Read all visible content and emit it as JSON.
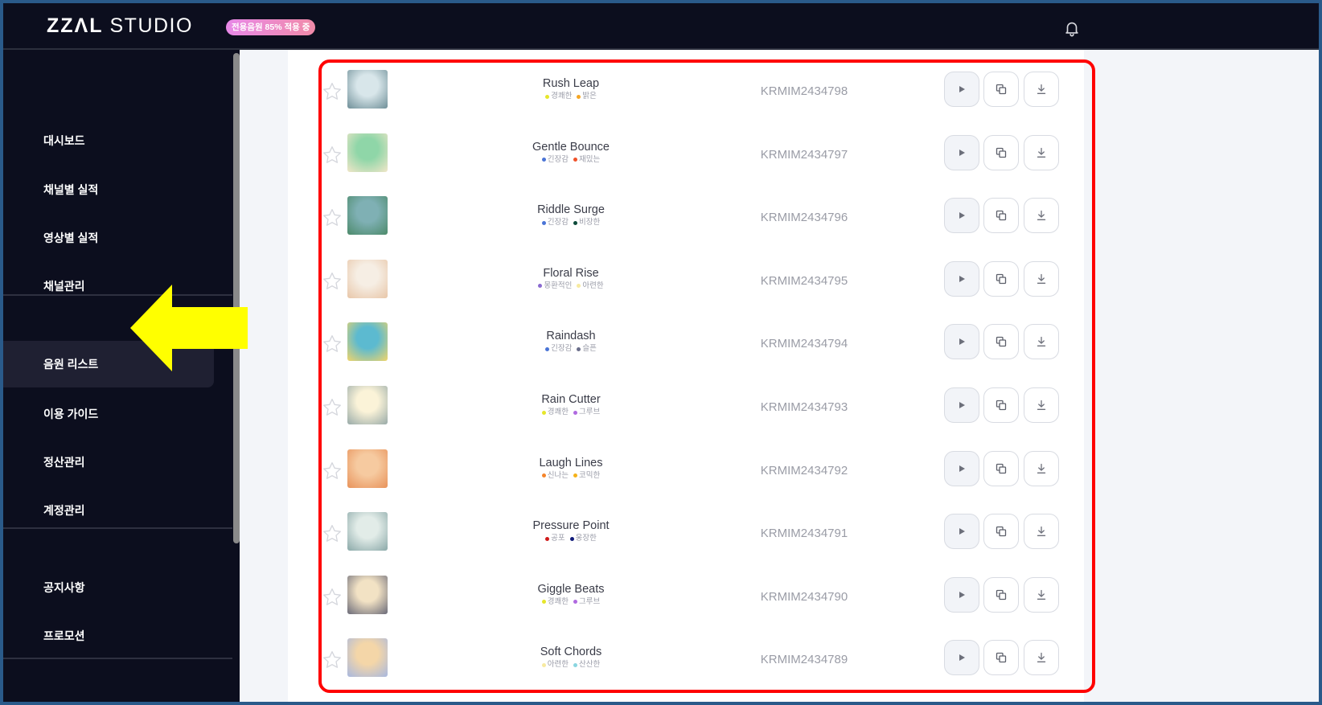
{
  "header": {
    "logo_mark": "ZZΛL",
    "logo_text": "STUDIO",
    "promo_badge": "전용음원 85% 적용 중",
    "notification_icon": "bell-icon"
  },
  "sidebar": {
    "groups": [
      {
        "items": [
          {
            "label": "대시보드",
            "active": false
          },
          {
            "label": "채널별 실적",
            "active": false
          },
          {
            "label": "영상별 실적",
            "active": false
          },
          {
            "label": "채널관리",
            "active": false
          }
        ]
      },
      {
        "items": [
          {
            "label": "음원 리스트",
            "active": true
          },
          {
            "label": "이용 가이드",
            "active": false
          },
          {
            "label": "정산관리",
            "active": false
          },
          {
            "label": "계정관리",
            "active": false
          }
        ]
      },
      {
        "items": [
          {
            "label": "공지사항",
            "active": false
          },
          {
            "label": "프로모션",
            "active": false
          }
        ]
      }
    ]
  },
  "annotation": {
    "arrow_color": "#ffff00",
    "highlight_color": "#ff0000"
  },
  "tracks": [
    {
      "title": "Rush Leap",
      "id": "KRMIM2434798",
      "tags": [
        {
          "label": "경쾌한",
          "color": "#e6e62a"
        },
        {
          "label": "밝은",
          "color": "#f5a623"
        }
      ],
      "thumb": [
        "#d8e6ea",
        "#6f8f98"
      ]
    },
    {
      "title": "Gentle Bounce",
      "id": "KRMIM2434797",
      "tags": [
        {
          "label": "긴장감",
          "color": "#4a74d6"
        },
        {
          "label": "재밌는",
          "color": "#f0522a"
        }
      ],
      "thumb": [
        "#8fd6a8",
        "#f1e6c8"
      ]
    },
    {
      "title": "Riddle Surge",
      "id": "KRMIM2434796",
      "tags": [
        {
          "label": "긴장감",
          "color": "#4a74d6"
        },
        {
          "label": "비장한",
          "color": "#0d4a3a"
        }
      ],
      "thumb": [
        "#7fb0b4",
        "#4c8a6a"
      ]
    },
    {
      "title": "Floral Rise",
      "id": "KRMIM2434795",
      "tags": [
        {
          "label": "몽환적인",
          "color": "#8a6ad0"
        },
        {
          "label": "아련한",
          "color": "#f7eaa0"
        }
      ],
      "thumb": [
        "#f6eee4",
        "#e8c6a8"
      ]
    },
    {
      "title": "Raindash",
      "id": "KRMIM2434794",
      "tags": [
        {
          "label": "긴장감",
          "color": "#4a74d6"
        },
        {
          "label": "슬픈",
          "color": "#6a6e8a"
        }
      ],
      "thumb": [
        "#5cbad0",
        "#f1d56a"
      ]
    },
    {
      "title": "Rain Cutter",
      "id": "KRMIM2434793",
      "tags": [
        {
          "label": "경쾌한",
          "color": "#e6e62a"
        },
        {
          "label": "그루브",
          "color": "#b06ae0"
        }
      ],
      "thumb": [
        "#fbf3d8",
        "#98aaa8"
      ]
    },
    {
      "title": "Laugh Lines",
      "id": "KRMIM2434792",
      "tags": [
        {
          "label": "신나는",
          "color": "#f5842a"
        },
        {
          "label": "코믹한",
          "color": "#f5b21a"
        }
      ],
      "thumb": [
        "#f6caa0",
        "#e8925a"
      ]
    },
    {
      "title": "Pressure Point",
      "id": "KRMIM2434791",
      "tags": [
        {
          "label": "공포",
          "color": "#d01a1a"
        },
        {
          "label": "웅장한",
          "color": "#101a7a"
        }
      ],
      "thumb": [
        "#e2ece8",
        "#8aa8a8"
      ]
    },
    {
      "title": "Giggle Beats",
      "id": "KRMIM2434790",
      "tags": [
        {
          "label": "경쾌한",
          "color": "#e6e62a"
        },
        {
          "label": "그루브",
          "color": "#b06ae0"
        }
      ],
      "thumb": [
        "#f2e2c4",
        "#6a6a78"
      ]
    },
    {
      "title": "Soft Chords",
      "id": "KRMIM2434789",
      "tags": [
        {
          "label": "아련한",
          "color": "#f7eaa0"
        },
        {
          "label": "산산한",
          "color": "#8ad6e0"
        }
      ],
      "thumb": [
        "#f4d6a8",
        "#a8b8e0"
      ]
    }
  ],
  "row_actions": {
    "play_icon": "play-icon",
    "copy_icon": "copy-icon",
    "download_icon": "download-icon",
    "favorite_icon": "star-outline-icon"
  }
}
